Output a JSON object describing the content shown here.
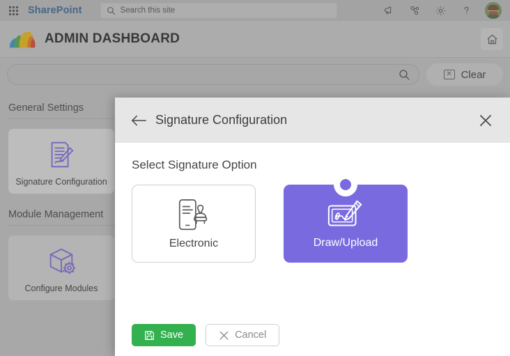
{
  "suitebar": {
    "waffle_label": "app-launcher",
    "brand": "SharePoint",
    "search_placeholder": "Search this site",
    "search_value": "",
    "actions": [
      {
        "name": "megaphone-icon",
        "label": "Announcements"
      },
      {
        "name": "org-people-icon",
        "label": "Org"
      },
      {
        "name": "gear-icon",
        "label": "Settings"
      },
      {
        "name": "help-icon",
        "label": "?"
      }
    ],
    "avatar_label": "User account"
  },
  "header": {
    "title": "ADMIN DASHBOARD",
    "home_label": "Home",
    "logo_colors": [
      "#2b8ec4",
      "#4aa349",
      "#e8b20e",
      "#e8770f",
      "#d63c2a"
    ]
  },
  "search": {
    "value": "",
    "placeholder": "",
    "clear_label": "Clear",
    "clear_icon": "boxed-x-icon",
    "search_icon": "search-icon"
  },
  "sidebar": {
    "sections": [
      {
        "title": "General Settings",
        "tiles": [
          {
            "label": "Signature Configuration",
            "icon": "document-pen-icon",
            "variant": "light"
          }
        ]
      },
      {
        "title": "Module Management",
        "tiles": [
          {
            "label": "Configure Modules",
            "icon": "cube-gear-icon",
            "variant": "dark"
          }
        ]
      }
    ]
  },
  "modal": {
    "title": "Signature Configuration",
    "back_label": "Back",
    "close_label": "Close",
    "section_label": "Select Signature Option",
    "options": [
      {
        "label": "Electronic",
        "icon": "phone-stamp-icon",
        "selected": false
      },
      {
        "label": "Draw/Upload",
        "icon": "signature-pad-pen-icon",
        "selected": true
      }
    ],
    "buttons": {
      "save_label": "Save",
      "save_icon": "floppy-disk-icon",
      "cancel_label": "Cancel",
      "cancel_icon": "x-icon"
    }
  },
  "colors": {
    "accent_purple": "#7a6ae0",
    "save_green": "#32b14e",
    "brand_blue": "#30618e",
    "page_bg": "#bdbdbd",
    "modal_header": "#e6e6e6"
  }
}
